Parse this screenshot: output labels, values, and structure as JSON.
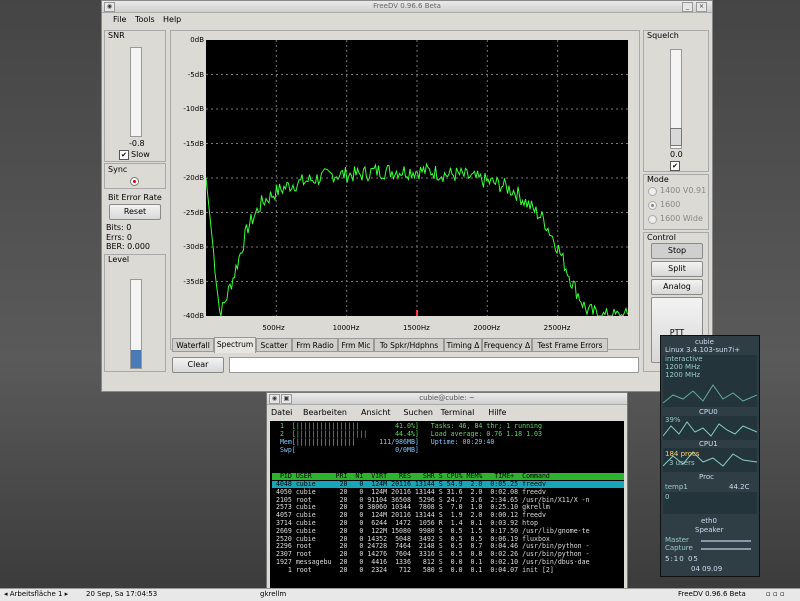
{
  "window": {
    "title": "FreeDV 0.96.6 Beta"
  },
  "menu": {
    "file": "File",
    "tools": "Tools",
    "help": "Help"
  },
  "snr": {
    "label": "SNR",
    "value": "-0.8",
    "slow_label": "Slow",
    "slow_checked": true,
    "level": 0.0
  },
  "sync": {
    "label": "Sync"
  },
  "ber": {
    "label": "Bit Error Rate",
    "reset": "Reset",
    "bits": "Bits: 0",
    "errs": "Errs: 0",
    "ber": "BER: 0.000"
  },
  "level": {
    "label": "Level",
    "value": 0.2
  },
  "squelch": {
    "label": "Squelch",
    "value": "0.0"
  },
  "mode": {
    "label": "Mode",
    "options": [
      "1400 V0.91",
      "1600",
      "1600 Wide"
    ],
    "selected": "1600"
  },
  "control": {
    "label": "Control",
    "stop": "Stop",
    "split": "Split",
    "analog": "Analog",
    "ptt": "PTT"
  },
  "plot": {
    "y_ticks": [
      "0dB",
      "-5dB",
      "-10dB",
      "-15dB",
      "-20dB",
      "-25dB",
      "-30dB",
      "-35dB",
      "-40dB"
    ],
    "x_ticks": [
      "500Hz",
      "1000Hz",
      "1500Hz",
      "2000Hz",
      "2500Hz"
    ]
  },
  "chart_data": {
    "type": "line",
    "xlabel": "",
    "ylabel": "",
    "xlim": [
      0,
      3000
    ],
    "ylim": [
      -40,
      0
    ],
    "grid": true,
    "series": [
      {
        "color": "#39ff39",
        "x": [
          0,
          100,
          200,
          300,
          400,
          500,
          600,
          700,
          800,
          900,
          1000,
          1100,
          1200,
          1300,
          1400,
          1500,
          1600,
          1700,
          1800,
          1900,
          2000,
          2100,
          2200,
          2300,
          2400,
          2500,
          2600,
          2700,
          2800
        ],
        "y": [
          -20,
          -40,
          -34,
          -27,
          -23.5,
          -22,
          -21,
          -20.5,
          -20,
          -19.5,
          -19.5,
          -19.5,
          -19,
          -19,
          -19,
          -19,
          -19,
          -19.5,
          -19.5,
          -20,
          -20.5,
          -21,
          -22,
          -24,
          -26,
          -30,
          -35,
          -39,
          -40
        ]
      }
    ],
    "marker_x": 1500
  },
  "tabs": [
    "Waterfall",
    "Spectrum",
    "Scatter",
    "Frm Radio",
    "Frm Mic",
    "To Spkr/Hdphns",
    "Timing Δ",
    "Frequency Δ",
    "Test Frame Errors"
  ],
  "active_tab": "Spectrum",
  "clear": "Clear",
  "terminal": {
    "title": "cubie@cubie: ~",
    "menu": [
      "Datei",
      "Bearbeiten",
      "Ansicht",
      "Suchen",
      "Terminal",
      "Hilfe"
    ],
    "header": [
      "  1  [||||||||||||||||         41.0%]   Tasks: 46, 84 thr; 1 running",
      "  2  [||||||||||||||||||       44.4%]   Load average: 0.76 1.18 1.03",
      "  Mem[|||||||||||||||      111/986MB]   Uptime: 00:29:40",
      "  Swp[                         0/0MB]"
    ],
    "columns": "  PID USER      PRI  NI  VIRT   RES   SHR S CPU% MEM%   TIME+  Command",
    "rows": [
      " 4048 cubie      20   0  124M 20116 13144 S 54.9  2.0  0:05.25 freedv",
      " 4050 cubie      20   0  124M 20116 13144 S 31.6  2.0  0:02.08 freedv",
      " 2105 root       20   0 91104 36508  5296 S 24.7  3.6  2:34.65 /usr/bin/X11/X -n",
      " 2573 cubie      20   0 38060 10344  7808 S  7.0  1.0  0:25.10 gkrellm",
      " 4057 cubie      20   0  124M 20116 13144 S  1.9  2.0  0:00.12 freedv",
      " 3714 cubie      20   0  6244  1472  1056 R  1.4  0.1  0:03.92 htop",
      " 2669 cubie      20   0  122M 15080  9980 S  0.5  1.5  0:17.50 /usr/lib/gnome-te",
      " 2520 cubie      20   0 14352  5048  3492 S  0.5  0.5  0:06.19 fluxbox",
      " 2296 root       20   0 24728  7464  2148 S  0.5  0.7  0:04.46 /usr/bin/python -",
      " 2307 root       20   0 14276  7604  3316 S  0.5  0.8  0:02.26 /usr/bin/python -",
      " 1927 messagebu  20   0  4416  1336   812 S  0.0  0.1  0:02.10 /usr/bin/dbus-dae",
      "    1 root       20   0  2324   712   580 S  0.0  0.1  0:04.07 init [2]"
    ]
  },
  "gkrellm": {
    "host": "cubie",
    "kernel": "Linux 3.4.103-sun7i+",
    "governor": "interactive",
    "freq1": "1200 MHz",
    "freq2": "1200 MHz",
    "cpu0": "CPU0",
    "cpu0_pct": "39%",
    "cpu1": "CPU1",
    "procs": "184 procs",
    "users": "3 users",
    "proc": "Proc",
    "temp_label": "temp1",
    "temp_value": "44.2C",
    "net_val": "0",
    "eth0": "eth0",
    "speaker": "Speaker",
    "master": "Master",
    "capture": "Capture",
    "clock": "5:10 05",
    "date": "04 09.09"
  },
  "taskbar": {
    "workspace": "◂ Arbeitsfläche 1 ▸",
    "datetime": "20 Sep, Sa 17:04:53",
    "task_gkrellm": "gkrellm",
    "task_freedv": "FreeDV 0.96.6 Beta"
  }
}
